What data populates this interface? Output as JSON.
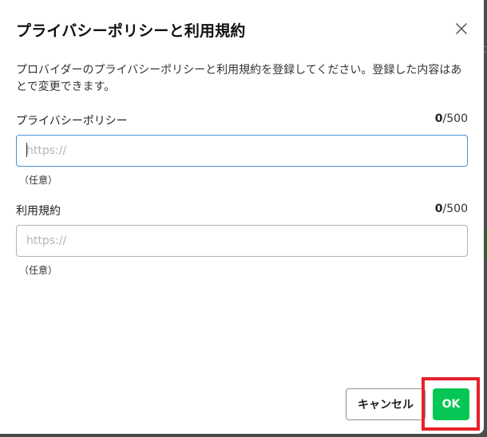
{
  "dialog": {
    "title": "プライバシーポリシーと利用規約",
    "description": "プロバイダーのプライバシーポリシーと利用規約を登録してください。登録した内容はあとで変更できます。",
    "close_icon": "close-icon"
  },
  "privacy": {
    "label": "プライバシーポリシー",
    "count": "0",
    "max": "/500",
    "value": "",
    "placeholder": "https://",
    "hint": "（任意）"
  },
  "terms": {
    "label": "利用規約",
    "count": "0",
    "max": "/500",
    "value": "",
    "placeholder": "https://",
    "hint": "（任意）"
  },
  "buttons": {
    "cancel": "キャンセル",
    "ok": "OK"
  },
  "colors": {
    "ok": "#06c755",
    "highlight": "#e8202a",
    "focus": "#4a8fd6"
  }
}
